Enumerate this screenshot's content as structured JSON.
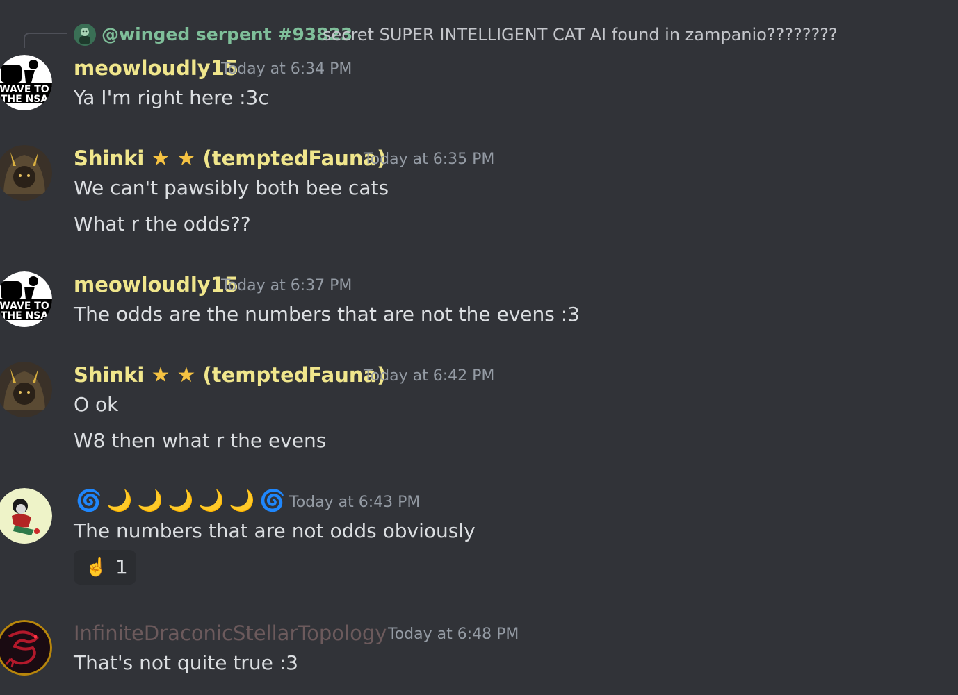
{
  "reply": {
    "author": "@winged serpent #93823",
    "text": "secret SUPER INTELLIGENT CAT AI found in zampanio????????"
  },
  "messages": [
    {
      "author": "meowloudly15",
      "time": "Today at 6:34 PM",
      "lines": [
        "Ya I'm right here :3c"
      ],
      "avatar_text": [
        "WAVE TO",
        "THE NSA"
      ]
    },
    {
      "author_name": "Shinki",
      "author_suffix": "(temptedFauna)",
      "time": "Today at 6:35 PM",
      "lines": [
        "We can't pawsibly both bee cats",
        "What r the odds??"
      ]
    },
    {
      "author": "meowloudly15",
      "time": "Today at 6:37 PM",
      "lines": [
        "The odds are the numbers that are not the evens :3"
      ],
      "avatar_text": [
        "WAVE TO",
        "THE NSA"
      ]
    },
    {
      "author_name": "Shinki",
      "author_suffix": "(temptedFauna)",
      "time": "Today at 6:42 PM",
      "lines": [
        "O ok",
        "W8 then what r the evens"
      ]
    },
    {
      "author_emojis": [
        "🌀",
        "🌙",
        "🌙",
        "🌙",
        "🌙",
        "🌙",
        "🌀"
      ],
      "time": "Today at 6:43 PM",
      "lines": [
        "The numbers that are not odds obviously"
      ],
      "reaction": {
        "emoji": "☝️",
        "count": "1"
      }
    },
    {
      "author": "InfiniteDraconicStellarTopology",
      "time": "Today at 6:48 PM",
      "lines": [
        "That's not quite true :3"
      ]
    }
  ],
  "icons": {
    "star": "★",
    "swirl": "🌀",
    "moon": "🌙"
  },
  "colors": {
    "background": "#313338",
    "username_yellow": "#f0e68c",
    "timestamp": "#949ba4",
    "text": "#dbdee1",
    "reply_name": "#7fbf9a",
    "dim_name": "#6c5a5c"
  }
}
